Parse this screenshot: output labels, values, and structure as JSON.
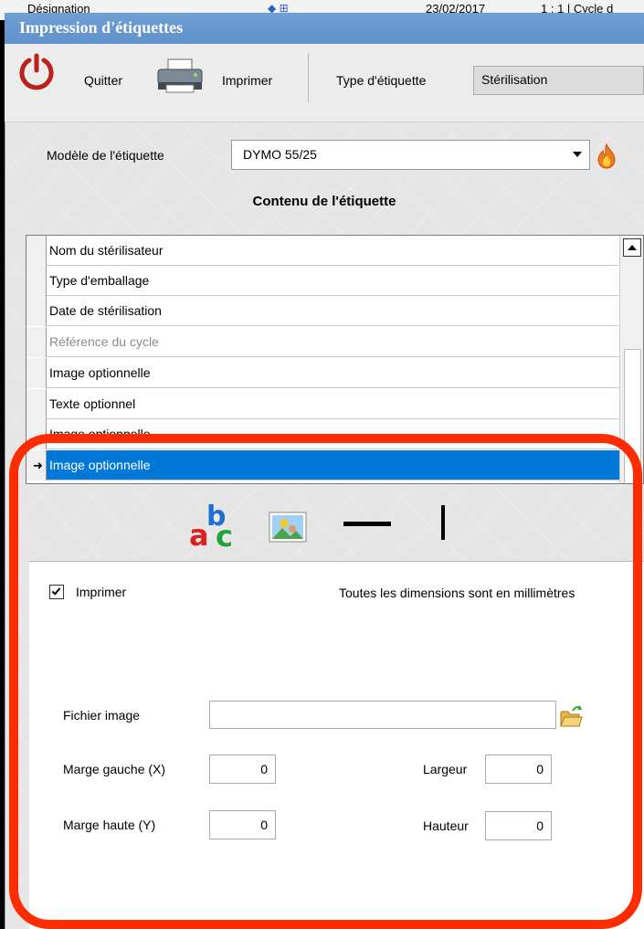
{
  "background_app": {
    "col1": "Désignation",
    "col2": "23/02/2017",
    "col3": "1 : 1 | Cycle d"
  },
  "dialog": {
    "title": "Impression d'étiquettes"
  },
  "toolbar": {
    "quit_label": "Quitter",
    "print_label": "Imprimer",
    "label_type_label": "Type d'étiquette",
    "label_type_value": "Stérilisation"
  },
  "model": {
    "label": "Modèle de l'étiquette",
    "value": "DYMO 55/25"
  },
  "content": {
    "title": "Contenu de l'étiquette",
    "items": [
      {
        "label": "Nom du stérilisateur",
        "state": "normal"
      },
      {
        "label": "Type d'emballage",
        "state": "normal"
      },
      {
        "label": "Date de stérilisation",
        "state": "normal"
      },
      {
        "label": "Référence du cycle",
        "state": "disabled"
      },
      {
        "label": "Image optionnelle",
        "state": "normal"
      },
      {
        "label": "Texte optionnel",
        "state": "normal"
      },
      {
        "label": "Image optionnelle",
        "state": "normal"
      },
      {
        "label": "Image optionnelle",
        "state": "selected"
      }
    ]
  },
  "tools": [
    "text-tool-icon",
    "image-tool-icon",
    "horizontal-line-icon",
    "vertical-line-icon"
  ],
  "properties": {
    "print_checkbox_label": "Imprimer",
    "print_checked": true,
    "dimensions_note": "Toutes les dimensions sont en millimètres",
    "image_file_label": "Fichier image",
    "image_file_value": "",
    "margin_left_label": "Marge gauche (X)",
    "margin_left_value": "0",
    "margin_top_label": "Marge haute (Y)",
    "margin_top_value": "0",
    "width_label": "Largeur",
    "width_value": "0",
    "height_label": "Hauteur",
    "height_value": "0"
  },
  "colors": {
    "title_bar": "#5f92cc",
    "selection": "#0078d7",
    "highlight": "#ff2c00"
  }
}
